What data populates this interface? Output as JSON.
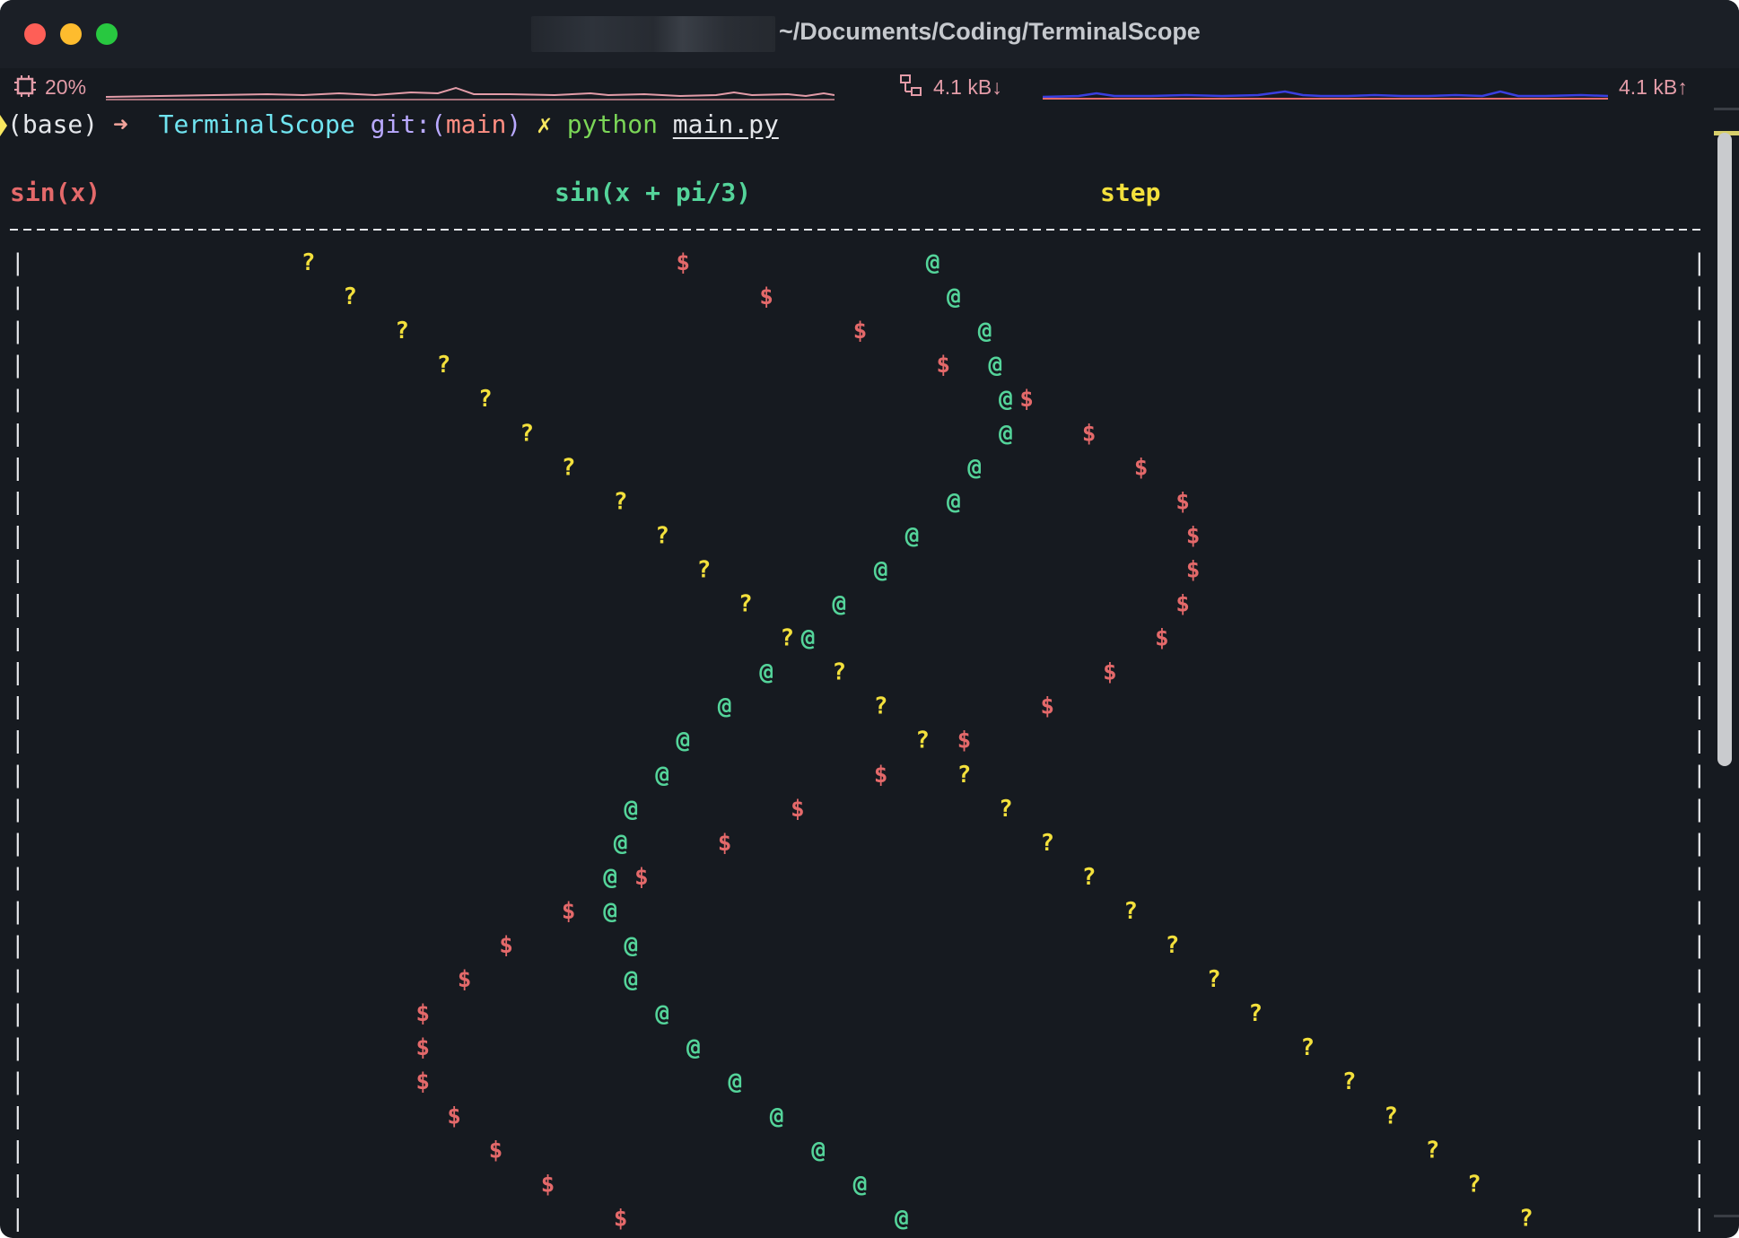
{
  "window": {
    "title_path": "~/Documents/Coding/TerminalScope",
    "bg_color": "#161a20"
  },
  "status_bar": {
    "cpu_icon": "cpu-icon",
    "cpu_percent": "20%",
    "net_icon": "network-icon",
    "net_down": "4.1 kB↓",
    "net_up": "4.1 kB↑"
  },
  "prompt": {
    "env": "(base)",
    "arrow": "➜",
    "dir": "TerminalScope",
    "git_label": "git:(",
    "branch": "main",
    "git_close": ")",
    "dirty": "✗",
    "command": "python",
    "argument": "main.py"
  },
  "chart_data": {
    "type": "scatter",
    "title": "",
    "series": [
      {
        "name": "sin(x)",
        "glyph": "$",
        "color": "#e4696a"
      },
      {
        "name": "sin(x + pi/3)",
        "glyph": "@",
        "color": "#54d49a"
      },
      {
        "name": "step",
        "glyph": "?",
        "color": "#f3e03c"
      }
    ],
    "rows": 29,
    "grid_cols": 154,
    "columns": {
      "sin(x)": [
        64,
        72,
        81,
        89,
        97,
        103,
        108,
        112,
        113,
        113,
        112,
        110,
        105,
        99,
        91,
        83,
        75,
        68,
        60,
        53,
        47,
        43,
        39,
        39,
        39,
        42,
        46,
        51,
        58
      ],
      "sin(x + pi/3)": [
        88,
        90,
        93,
        94,
        95,
        95,
        92,
        90,
        86,
        83,
        79,
        76,
        72,
        68,
        64,
        62,
        59,
        58,
        57,
        57,
        59,
        59,
        62,
        65,
        69,
        73,
        77,
        81,
        85
      ],
      "step": [
        28,
        32,
        37,
        41,
        45,
        49,
        53,
        58,
        62,
        66,
        70,
        74,
        79,
        83,
        87,
        91,
        95,
        99,
        103,
        107,
        111,
        115,
        119,
        124,
        128,
        132,
        136,
        140,
        145
      ]
    },
    "frame": {
      "separator_char": "-",
      "border_char": "|"
    }
  }
}
